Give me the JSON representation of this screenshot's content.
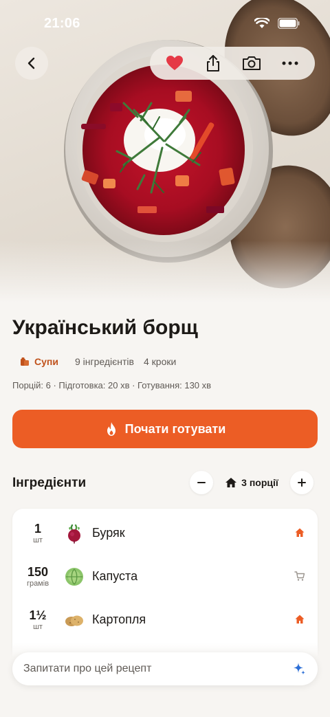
{
  "status_bar": {
    "time": "21:06"
  },
  "hero": {
    "image_icon": "borscht-photo"
  },
  "top_actions": {
    "back_icon": "chevron-left-icon",
    "favorite_icon": "heart-icon",
    "share_icon": "share-icon",
    "camera_icon": "camera-icon",
    "more_icon": "more-icon"
  },
  "recipe": {
    "title": "Український борщ",
    "category": "Супи",
    "ingredients_count": "9 інгредієнтів",
    "steps_count": "4 кроки",
    "details": "Порцій: 6 · Підготовка: 20 хв · Готування: 130 хв"
  },
  "start_button": {
    "label": "Почати готувати"
  },
  "ingredients": {
    "title": "Інгредієнти",
    "portions_label": "3 порції",
    "items": [
      {
        "qty": "1",
        "unit": "шт",
        "name": "Буряк",
        "status": "home"
      },
      {
        "qty": "150",
        "unit": "грамів",
        "name": "Капуста",
        "status": "cart"
      },
      {
        "qty": "1½",
        "unit": "шт",
        "name": "Картопля",
        "status": "home"
      }
    ]
  },
  "ask": {
    "placeholder": "Запитати про цей рецепт"
  },
  "colors": {
    "accent": "#ec5d25",
    "category": "#c0521c",
    "background": "#f7f5f2",
    "favorite": "#e53946"
  }
}
